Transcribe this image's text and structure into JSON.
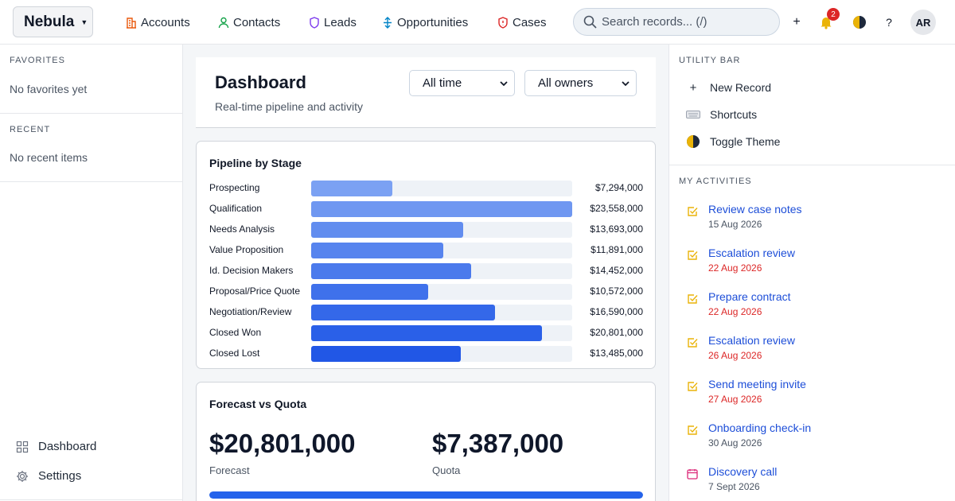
{
  "app": {
    "name": "Nebula"
  },
  "nav": [
    {
      "label": "Accounts",
      "icon": "building-icon",
      "color": "#ea580c"
    },
    {
      "label": "Contacts",
      "icon": "person-icon",
      "color": "#16a34a"
    },
    {
      "label": "Leads",
      "icon": "shield-icon",
      "color": "#7c3aed"
    },
    {
      "label": "Opportunities",
      "icon": "arrows-vertical-icon",
      "color": "#0284c7"
    },
    {
      "label": "Cases",
      "icon": "shield-alert-icon",
      "color": "#dc2626"
    }
  ],
  "search": {
    "placeholder": "Search records... (/)"
  },
  "topbar": {
    "plus": "+",
    "notifications_count": "2",
    "help": "?",
    "avatar_initials": "AR"
  },
  "left_sidebar": {
    "favorites_label": "FAVORITES",
    "favorites_empty": "No favorites yet",
    "recent_label": "RECENT",
    "recent_empty": "No recent items",
    "links": [
      {
        "label": "Dashboard",
        "icon": "grid-icon"
      },
      {
        "label": "Settings",
        "icon": "gear-icon"
      }
    ]
  },
  "dashboard": {
    "title": "Dashboard",
    "subtitle": "Real-time pipeline and activity",
    "filter_time": "All time",
    "filter_owner": "All owners"
  },
  "pipeline": {
    "title": "Pipeline by Stage",
    "stages": [
      {
        "label": "Prospecting",
        "value": "$7,294,000",
        "amount": 7294000,
        "color": "#7ba1f3"
      },
      {
        "label": "Qualification",
        "value": "$23,558,000",
        "amount": 23558000,
        "color": "#6f97f1"
      },
      {
        "label": "Needs Analysis",
        "value": "$13,693,000",
        "amount": 13693000,
        "color": "#628def"
      },
      {
        "label": "Value Proposition",
        "value": "$11,891,000",
        "amount": 11891000,
        "color": "#5784ee"
      },
      {
        "label": "Id. Decision Makers",
        "value": "$14,452,000",
        "amount": 14452000,
        "color": "#4b7aec"
      },
      {
        "label": "Proposal/Price Quote",
        "value": "$10,572,000",
        "amount": 10572000,
        "color": "#3f71eb"
      },
      {
        "label": "Negotiation/Review",
        "value": "$16,590,000",
        "amount": 16590000,
        "color": "#3468e9"
      },
      {
        "label": "Closed Won",
        "value": "$20,801,000",
        "amount": 20801000,
        "color": "#2a60e8"
      },
      {
        "label": "Closed Lost",
        "value": "$13,485,000",
        "amount": 13485000,
        "color": "#2157e6"
      }
    ],
    "max": 23558000
  },
  "forecast": {
    "title": "Forecast vs Quota",
    "forecast_value": "$20,801,000",
    "forecast_label": "Forecast",
    "quota_value": "$7,387,000",
    "quota_label": "Quota",
    "progress_fraction": 1.0
  },
  "utility_bar": {
    "label": "UTILITY BAR",
    "items": [
      {
        "label": "New Record",
        "icon": "plus-icon"
      },
      {
        "label": "Shortcuts",
        "icon": "keyboard-icon"
      },
      {
        "label": "Toggle Theme",
        "icon": "half-moon-icon"
      }
    ]
  },
  "activities": {
    "label": "MY ACTIVITIES",
    "items": [
      {
        "title": "Review case notes",
        "date": "15 Aug 2026",
        "overdue": false,
        "icon": "task-check-icon"
      },
      {
        "title": "Escalation review",
        "date": "22 Aug 2026",
        "overdue": true,
        "icon": "task-check-icon"
      },
      {
        "title": "Prepare contract",
        "date": "22 Aug 2026",
        "overdue": true,
        "icon": "task-check-icon"
      },
      {
        "title": "Escalation review",
        "date": "26 Aug 2026",
        "overdue": true,
        "icon": "task-check-icon"
      },
      {
        "title": "Send meeting invite",
        "date": "27 Aug 2026",
        "overdue": true,
        "icon": "task-check-icon"
      },
      {
        "title": "Onboarding check-in",
        "date": "30 Aug 2026",
        "overdue": false,
        "icon": "task-check-icon"
      },
      {
        "title": "Discovery call",
        "date": "7 Sept 2026",
        "overdue": false,
        "icon": "calendar-icon"
      }
    ]
  },
  "colors": {
    "accent": "#2563eb",
    "task_icon": "#eab308",
    "calendar_icon": "#db2777",
    "link": "#1d4ed8",
    "overdue": "#dc2626"
  }
}
